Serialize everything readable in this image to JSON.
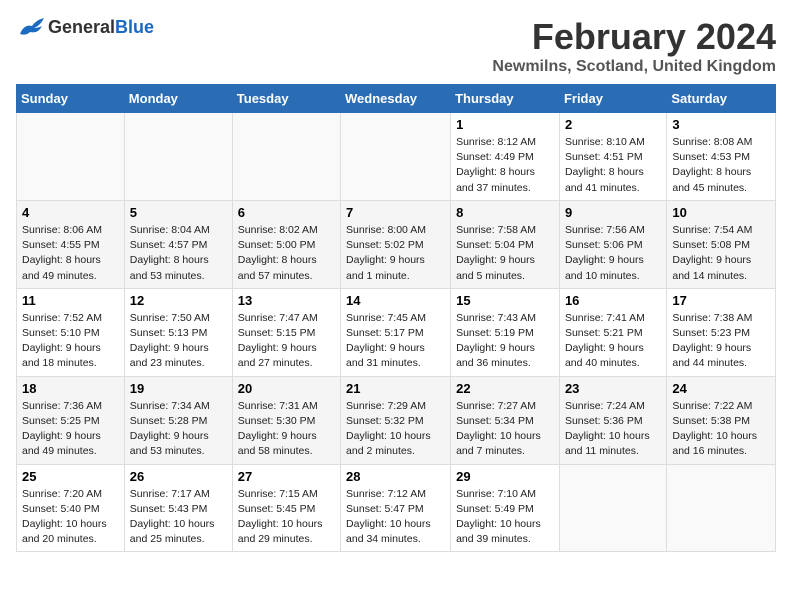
{
  "logo": {
    "text_general": "General",
    "text_blue": "Blue"
  },
  "title": "February 2024",
  "subtitle": "Newmilns, Scotland, United Kingdom",
  "days_of_week": [
    "Sunday",
    "Monday",
    "Tuesday",
    "Wednesday",
    "Thursday",
    "Friday",
    "Saturday"
  ],
  "weeks": [
    [
      {
        "day": "",
        "info": ""
      },
      {
        "day": "",
        "info": ""
      },
      {
        "day": "",
        "info": ""
      },
      {
        "day": "",
        "info": ""
      },
      {
        "day": "1",
        "info": "Sunrise: 8:12 AM\nSunset: 4:49 PM\nDaylight: 8 hours\nand 37 minutes."
      },
      {
        "day": "2",
        "info": "Sunrise: 8:10 AM\nSunset: 4:51 PM\nDaylight: 8 hours\nand 41 minutes."
      },
      {
        "day": "3",
        "info": "Sunrise: 8:08 AM\nSunset: 4:53 PM\nDaylight: 8 hours\nand 45 minutes."
      }
    ],
    [
      {
        "day": "4",
        "info": "Sunrise: 8:06 AM\nSunset: 4:55 PM\nDaylight: 8 hours\nand 49 minutes."
      },
      {
        "day": "5",
        "info": "Sunrise: 8:04 AM\nSunset: 4:57 PM\nDaylight: 8 hours\nand 53 minutes."
      },
      {
        "day": "6",
        "info": "Sunrise: 8:02 AM\nSunset: 5:00 PM\nDaylight: 8 hours\nand 57 minutes."
      },
      {
        "day": "7",
        "info": "Sunrise: 8:00 AM\nSunset: 5:02 PM\nDaylight: 9 hours\nand 1 minute."
      },
      {
        "day": "8",
        "info": "Sunrise: 7:58 AM\nSunset: 5:04 PM\nDaylight: 9 hours\nand 5 minutes."
      },
      {
        "day": "9",
        "info": "Sunrise: 7:56 AM\nSunset: 5:06 PM\nDaylight: 9 hours\nand 10 minutes."
      },
      {
        "day": "10",
        "info": "Sunrise: 7:54 AM\nSunset: 5:08 PM\nDaylight: 9 hours\nand 14 minutes."
      }
    ],
    [
      {
        "day": "11",
        "info": "Sunrise: 7:52 AM\nSunset: 5:10 PM\nDaylight: 9 hours\nand 18 minutes."
      },
      {
        "day": "12",
        "info": "Sunrise: 7:50 AM\nSunset: 5:13 PM\nDaylight: 9 hours\nand 23 minutes."
      },
      {
        "day": "13",
        "info": "Sunrise: 7:47 AM\nSunset: 5:15 PM\nDaylight: 9 hours\nand 27 minutes."
      },
      {
        "day": "14",
        "info": "Sunrise: 7:45 AM\nSunset: 5:17 PM\nDaylight: 9 hours\nand 31 minutes."
      },
      {
        "day": "15",
        "info": "Sunrise: 7:43 AM\nSunset: 5:19 PM\nDaylight: 9 hours\nand 36 minutes."
      },
      {
        "day": "16",
        "info": "Sunrise: 7:41 AM\nSunset: 5:21 PM\nDaylight: 9 hours\nand 40 minutes."
      },
      {
        "day": "17",
        "info": "Sunrise: 7:38 AM\nSunset: 5:23 PM\nDaylight: 9 hours\nand 44 minutes."
      }
    ],
    [
      {
        "day": "18",
        "info": "Sunrise: 7:36 AM\nSunset: 5:25 PM\nDaylight: 9 hours\nand 49 minutes."
      },
      {
        "day": "19",
        "info": "Sunrise: 7:34 AM\nSunset: 5:28 PM\nDaylight: 9 hours\nand 53 minutes."
      },
      {
        "day": "20",
        "info": "Sunrise: 7:31 AM\nSunset: 5:30 PM\nDaylight: 9 hours\nand 58 minutes."
      },
      {
        "day": "21",
        "info": "Sunrise: 7:29 AM\nSunset: 5:32 PM\nDaylight: 10 hours\nand 2 minutes."
      },
      {
        "day": "22",
        "info": "Sunrise: 7:27 AM\nSunset: 5:34 PM\nDaylight: 10 hours\nand 7 minutes."
      },
      {
        "day": "23",
        "info": "Sunrise: 7:24 AM\nSunset: 5:36 PM\nDaylight: 10 hours\nand 11 minutes."
      },
      {
        "day": "24",
        "info": "Sunrise: 7:22 AM\nSunset: 5:38 PM\nDaylight: 10 hours\nand 16 minutes."
      }
    ],
    [
      {
        "day": "25",
        "info": "Sunrise: 7:20 AM\nSunset: 5:40 PM\nDaylight: 10 hours\nand 20 minutes."
      },
      {
        "day": "26",
        "info": "Sunrise: 7:17 AM\nSunset: 5:43 PM\nDaylight: 10 hours\nand 25 minutes."
      },
      {
        "day": "27",
        "info": "Sunrise: 7:15 AM\nSunset: 5:45 PM\nDaylight: 10 hours\nand 29 minutes."
      },
      {
        "day": "28",
        "info": "Sunrise: 7:12 AM\nSunset: 5:47 PM\nDaylight: 10 hours\nand 34 minutes."
      },
      {
        "day": "29",
        "info": "Sunrise: 7:10 AM\nSunset: 5:49 PM\nDaylight: 10 hours\nand 39 minutes."
      },
      {
        "day": "",
        "info": ""
      },
      {
        "day": "",
        "info": ""
      }
    ]
  ]
}
